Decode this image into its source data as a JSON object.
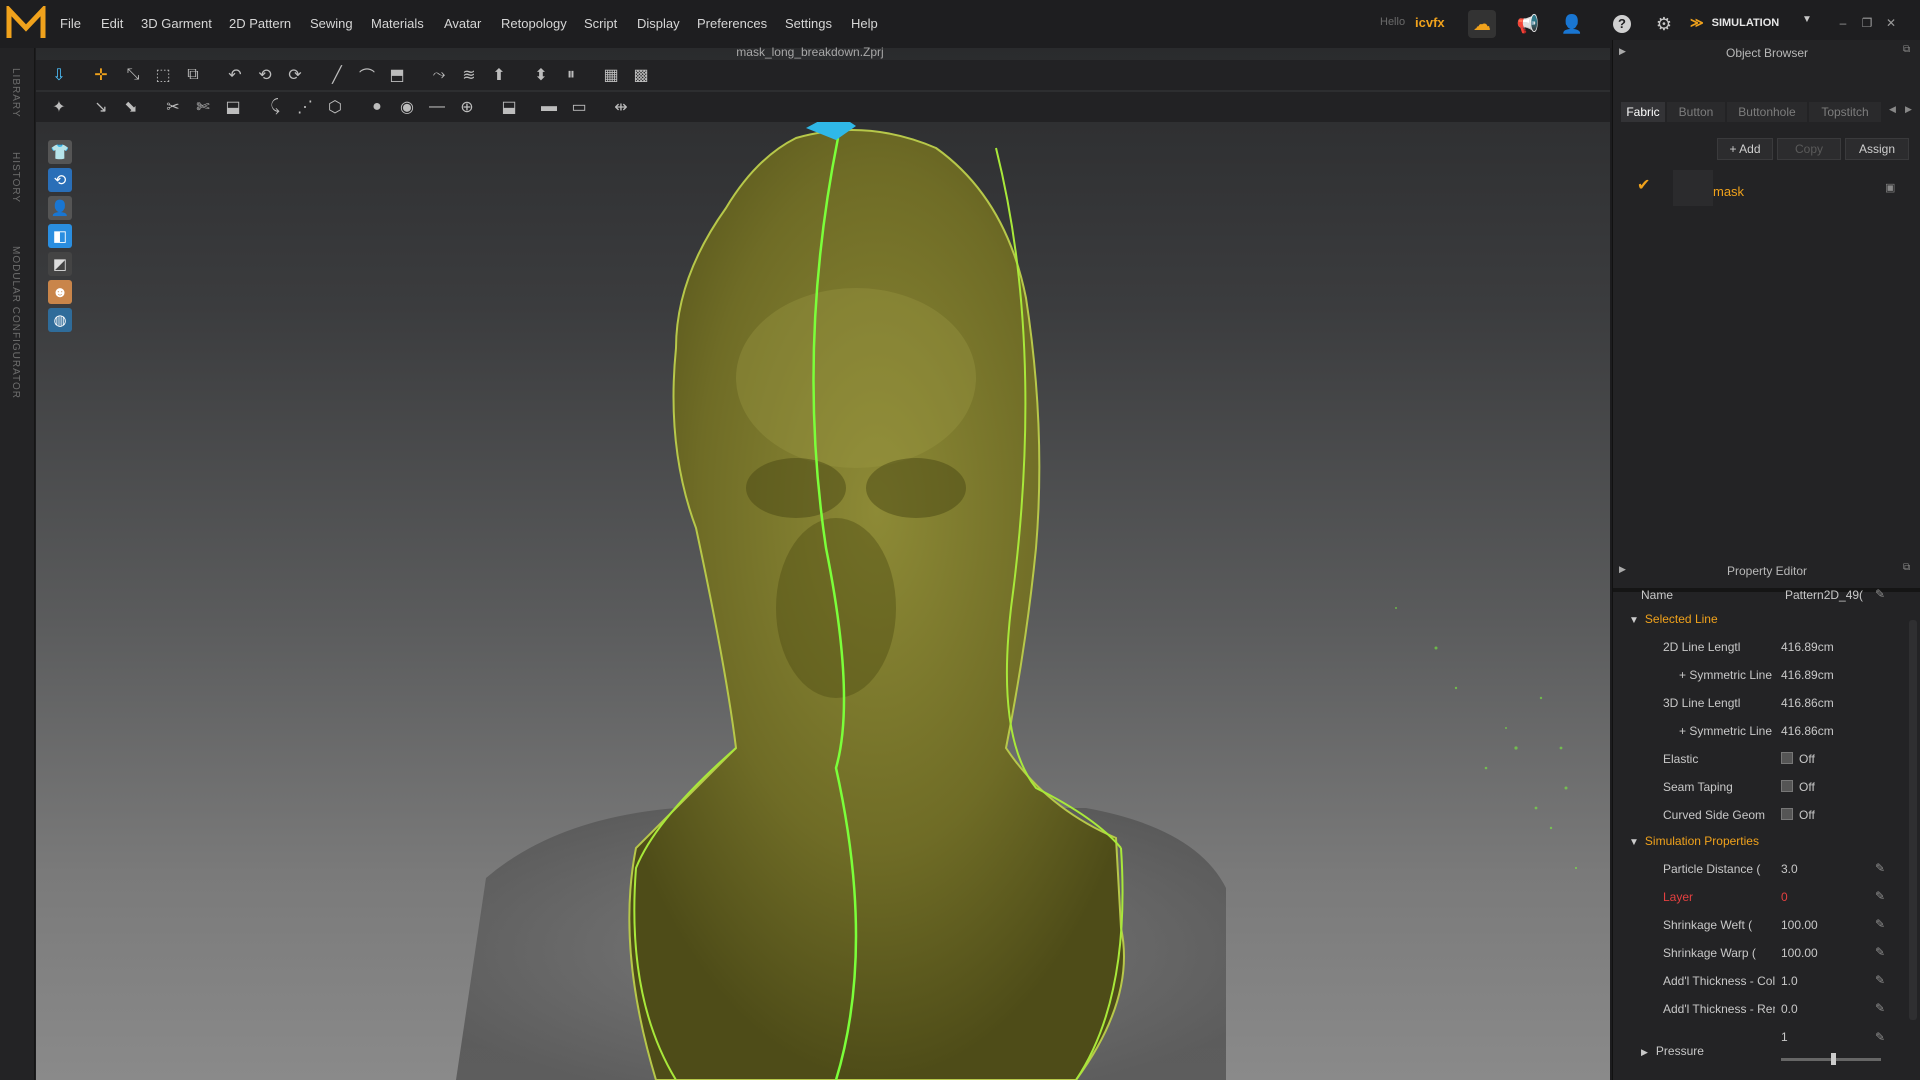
{
  "app": {
    "file_name": "mask_long_breakdown.Zprj",
    "greeting": "Hello",
    "username": "icvfx",
    "mode": "SIMULATION"
  },
  "menu": [
    "File",
    "Edit",
    "3D Garment",
    "2D Pattern",
    "Sewing",
    "Materials",
    "Avatar",
    "Retopology",
    "Script",
    "Display",
    "Preferences",
    "Settings",
    "Help"
  ],
  "left_tabs": [
    "LIBRARY",
    "HISTORY",
    "MODULAR CONFIGURATOR"
  ],
  "object_browser": {
    "title": "Object Browser",
    "tabs": [
      "Fabric",
      "Button",
      "Buttonhole",
      "Topstitch"
    ],
    "add_label": "+ Add",
    "copy_label": "Copy",
    "assign_label": "Assign",
    "items": [
      {
        "name": "mask"
      }
    ]
  },
  "property_editor": {
    "title": "Property Editor",
    "name_label": "Name",
    "name_value": "Pattern2D_49(",
    "selected_line": {
      "header": "Selected Line",
      "rows": [
        {
          "label": "2D Line Lengtl",
          "value": "416.89cm"
        },
        {
          "label": "+ Symmetric Line",
          "value": "416.89cm"
        },
        {
          "label": "3D Line Lengtl",
          "value": "416.86cm"
        },
        {
          "label": "+ Symmetric Line",
          "value": "416.86cm"
        },
        {
          "label": "Elastic",
          "value": "Off"
        },
        {
          "label": "Seam Taping",
          "value": "Off"
        },
        {
          "label": "Curved Side Geom",
          "value": "Off"
        }
      ]
    },
    "simulation_properties": {
      "header": "Simulation Properties",
      "rows": [
        {
          "label": "Particle Distance (",
          "value": "3.0"
        },
        {
          "label": "Layer",
          "value": "0"
        },
        {
          "label": "Shrinkage Weft (",
          "value": "100.00"
        },
        {
          "label": "Shrinkage Warp (",
          "value": "100.00"
        },
        {
          "label": "Add'l Thickness - Coll",
          "value": "1.0"
        },
        {
          "label": "Add'l Thickness - Ren",
          "value": "0.0"
        },
        {
          "label": "Pressure",
          "value": "1"
        }
      ]
    }
  },
  "colors": {
    "accent": "#f0a21c",
    "fabric": "#7d7a2c",
    "seam": "#7bff3a",
    "danger": "#e34040"
  }
}
